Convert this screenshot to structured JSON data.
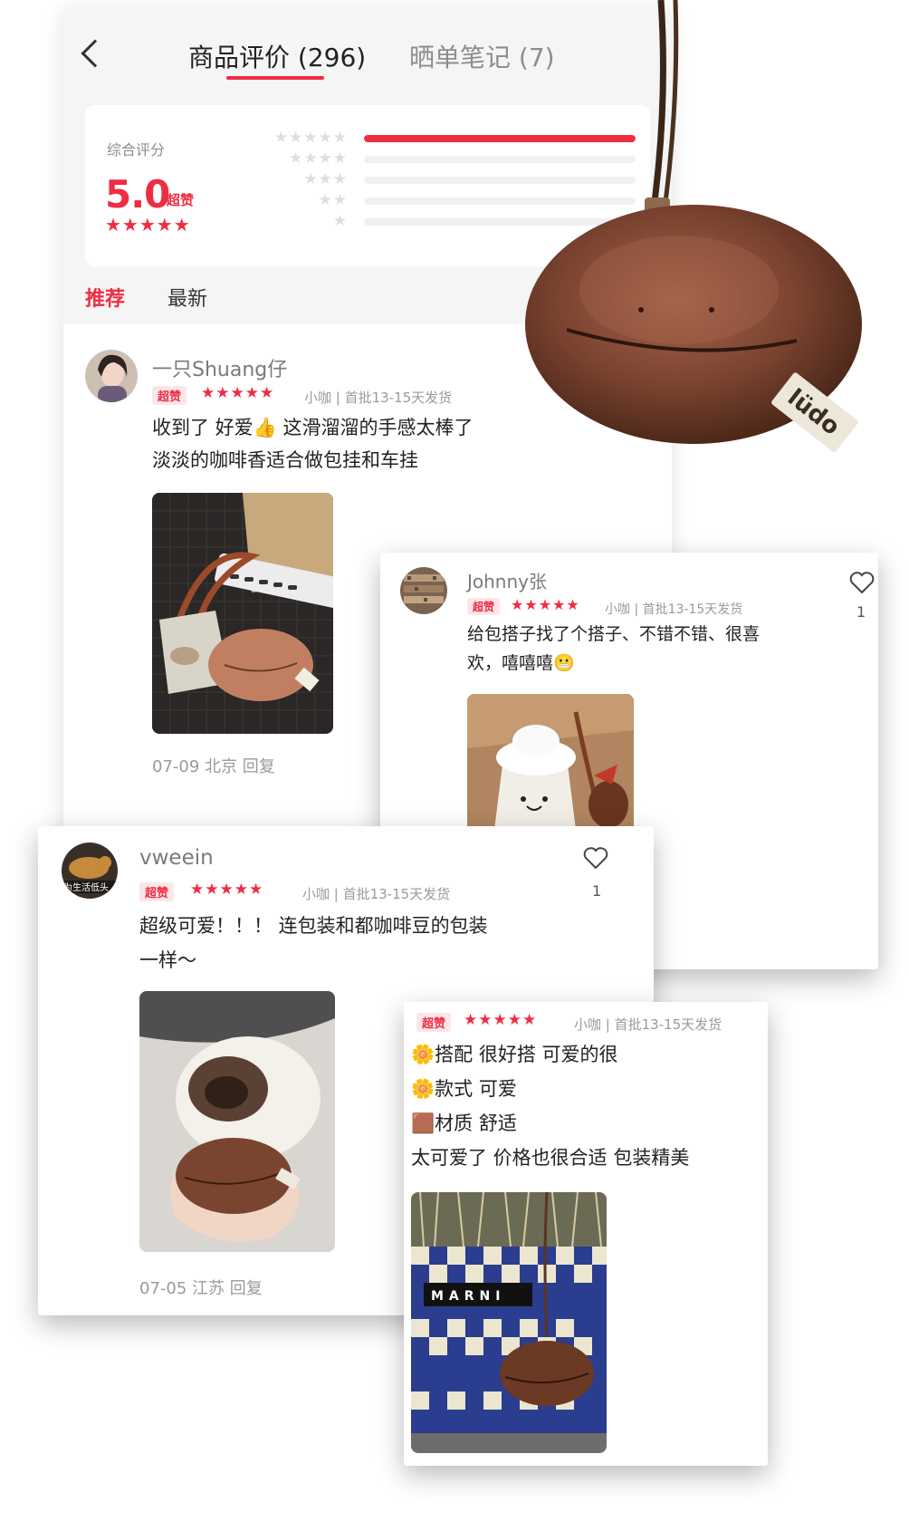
{
  "header": {
    "active_tab": "商品评价 (296)",
    "other_tab": "晒单笔记 (7)"
  },
  "summary": {
    "label": "综合评分",
    "score": "5.0",
    "score_word": "超赞",
    "stars": "★★★★★",
    "distribution": [
      {
        "stars": "★★★★★",
        "fraction": 1.0
      },
      {
        "stars": "★★★★",
        "fraction": 0.0
      },
      {
        "stars": "★★★",
        "fraction": 0.0
      },
      {
        "stars": "★★",
        "fraction": 0.0
      },
      {
        "stars": "★",
        "fraction": 0.0
      }
    ]
  },
  "filters": {
    "recommended": "推荐",
    "latest": "最新"
  },
  "brand_tag": "lüdo",
  "reviews": [
    {
      "user": "一只Shuang仔",
      "badge": "超赞",
      "stars": "★★★★★",
      "meta": "小咖 | 首批13-15天发货",
      "text_1": "收到了 好爱👍 这滑溜溜的手感太棒了",
      "text_2": "淡淡的咖啡香适合做包挂和车挂",
      "footer": "07-09 北京 回复"
    },
    {
      "user": "Johnny张",
      "badge": "超赞",
      "stars": "★★★★★",
      "meta": "小咖 | 首批13-15天发货",
      "text_1": "给包搭子找了个搭子、不错不错、很喜",
      "text_2": "欢，嘻嘻嘻😬",
      "likes": "1"
    },
    {
      "user": "vweein",
      "avatar_text": "为生活低头",
      "badge": "超赞",
      "stars": "★★★★★",
      "meta": "小咖 | 首批13-15天发货",
      "text_1": "超级可爱！！！ 连包装和都咖啡豆的包装",
      "text_2": "一样～",
      "footer": "07-05 江苏 回复",
      "likes": "1"
    },
    {
      "badge": "超赞",
      "stars": "★★★★★",
      "meta": "小咖 | 首批13-15天发货",
      "line_1": "🌼搭配 很好搭 可爱的很",
      "line_2": "🌼款式 可爱",
      "line_3": "🟫材质 舒适",
      "line_4": "太可爱了 价格也很合适 包装精美",
      "photo_text": "MARNI"
    }
  ]
}
